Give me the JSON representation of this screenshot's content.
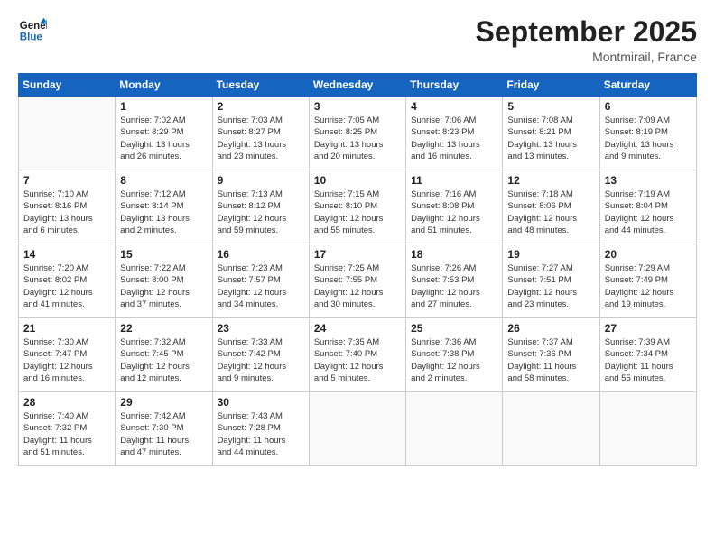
{
  "logo": {
    "line1": "General",
    "line2": "Blue"
  },
  "title": "September 2025",
  "location": "Montmirail, France",
  "weekdays": [
    "Sunday",
    "Monday",
    "Tuesday",
    "Wednesday",
    "Thursday",
    "Friday",
    "Saturday"
  ],
  "weeks": [
    [
      {
        "day": "",
        "info": ""
      },
      {
        "day": "1",
        "info": "Sunrise: 7:02 AM\nSunset: 8:29 PM\nDaylight: 13 hours\nand 26 minutes."
      },
      {
        "day": "2",
        "info": "Sunrise: 7:03 AM\nSunset: 8:27 PM\nDaylight: 13 hours\nand 23 minutes."
      },
      {
        "day": "3",
        "info": "Sunrise: 7:05 AM\nSunset: 8:25 PM\nDaylight: 13 hours\nand 20 minutes."
      },
      {
        "day": "4",
        "info": "Sunrise: 7:06 AM\nSunset: 8:23 PM\nDaylight: 13 hours\nand 16 minutes."
      },
      {
        "day": "5",
        "info": "Sunrise: 7:08 AM\nSunset: 8:21 PM\nDaylight: 13 hours\nand 13 minutes."
      },
      {
        "day": "6",
        "info": "Sunrise: 7:09 AM\nSunset: 8:19 PM\nDaylight: 13 hours\nand 9 minutes."
      }
    ],
    [
      {
        "day": "7",
        "info": "Sunrise: 7:10 AM\nSunset: 8:16 PM\nDaylight: 13 hours\nand 6 minutes."
      },
      {
        "day": "8",
        "info": "Sunrise: 7:12 AM\nSunset: 8:14 PM\nDaylight: 13 hours\nand 2 minutes."
      },
      {
        "day": "9",
        "info": "Sunrise: 7:13 AM\nSunset: 8:12 PM\nDaylight: 12 hours\nand 59 minutes."
      },
      {
        "day": "10",
        "info": "Sunrise: 7:15 AM\nSunset: 8:10 PM\nDaylight: 12 hours\nand 55 minutes."
      },
      {
        "day": "11",
        "info": "Sunrise: 7:16 AM\nSunset: 8:08 PM\nDaylight: 12 hours\nand 51 minutes."
      },
      {
        "day": "12",
        "info": "Sunrise: 7:18 AM\nSunset: 8:06 PM\nDaylight: 12 hours\nand 48 minutes."
      },
      {
        "day": "13",
        "info": "Sunrise: 7:19 AM\nSunset: 8:04 PM\nDaylight: 12 hours\nand 44 minutes."
      }
    ],
    [
      {
        "day": "14",
        "info": "Sunrise: 7:20 AM\nSunset: 8:02 PM\nDaylight: 12 hours\nand 41 minutes."
      },
      {
        "day": "15",
        "info": "Sunrise: 7:22 AM\nSunset: 8:00 PM\nDaylight: 12 hours\nand 37 minutes."
      },
      {
        "day": "16",
        "info": "Sunrise: 7:23 AM\nSunset: 7:57 PM\nDaylight: 12 hours\nand 34 minutes."
      },
      {
        "day": "17",
        "info": "Sunrise: 7:25 AM\nSunset: 7:55 PM\nDaylight: 12 hours\nand 30 minutes."
      },
      {
        "day": "18",
        "info": "Sunrise: 7:26 AM\nSunset: 7:53 PM\nDaylight: 12 hours\nand 27 minutes."
      },
      {
        "day": "19",
        "info": "Sunrise: 7:27 AM\nSunset: 7:51 PM\nDaylight: 12 hours\nand 23 minutes."
      },
      {
        "day": "20",
        "info": "Sunrise: 7:29 AM\nSunset: 7:49 PM\nDaylight: 12 hours\nand 19 minutes."
      }
    ],
    [
      {
        "day": "21",
        "info": "Sunrise: 7:30 AM\nSunset: 7:47 PM\nDaylight: 12 hours\nand 16 minutes."
      },
      {
        "day": "22",
        "info": "Sunrise: 7:32 AM\nSunset: 7:45 PM\nDaylight: 12 hours\nand 12 minutes."
      },
      {
        "day": "23",
        "info": "Sunrise: 7:33 AM\nSunset: 7:42 PM\nDaylight: 12 hours\nand 9 minutes."
      },
      {
        "day": "24",
        "info": "Sunrise: 7:35 AM\nSunset: 7:40 PM\nDaylight: 12 hours\nand 5 minutes."
      },
      {
        "day": "25",
        "info": "Sunrise: 7:36 AM\nSunset: 7:38 PM\nDaylight: 12 hours\nand 2 minutes."
      },
      {
        "day": "26",
        "info": "Sunrise: 7:37 AM\nSunset: 7:36 PM\nDaylight: 11 hours\nand 58 minutes."
      },
      {
        "day": "27",
        "info": "Sunrise: 7:39 AM\nSunset: 7:34 PM\nDaylight: 11 hours\nand 55 minutes."
      }
    ],
    [
      {
        "day": "28",
        "info": "Sunrise: 7:40 AM\nSunset: 7:32 PM\nDaylight: 11 hours\nand 51 minutes."
      },
      {
        "day": "29",
        "info": "Sunrise: 7:42 AM\nSunset: 7:30 PM\nDaylight: 11 hours\nand 47 minutes."
      },
      {
        "day": "30",
        "info": "Sunrise: 7:43 AM\nSunset: 7:28 PM\nDaylight: 11 hours\nand 44 minutes."
      },
      {
        "day": "",
        "info": ""
      },
      {
        "day": "",
        "info": ""
      },
      {
        "day": "",
        "info": ""
      },
      {
        "day": "",
        "info": ""
      }
    ]
  ]
}
